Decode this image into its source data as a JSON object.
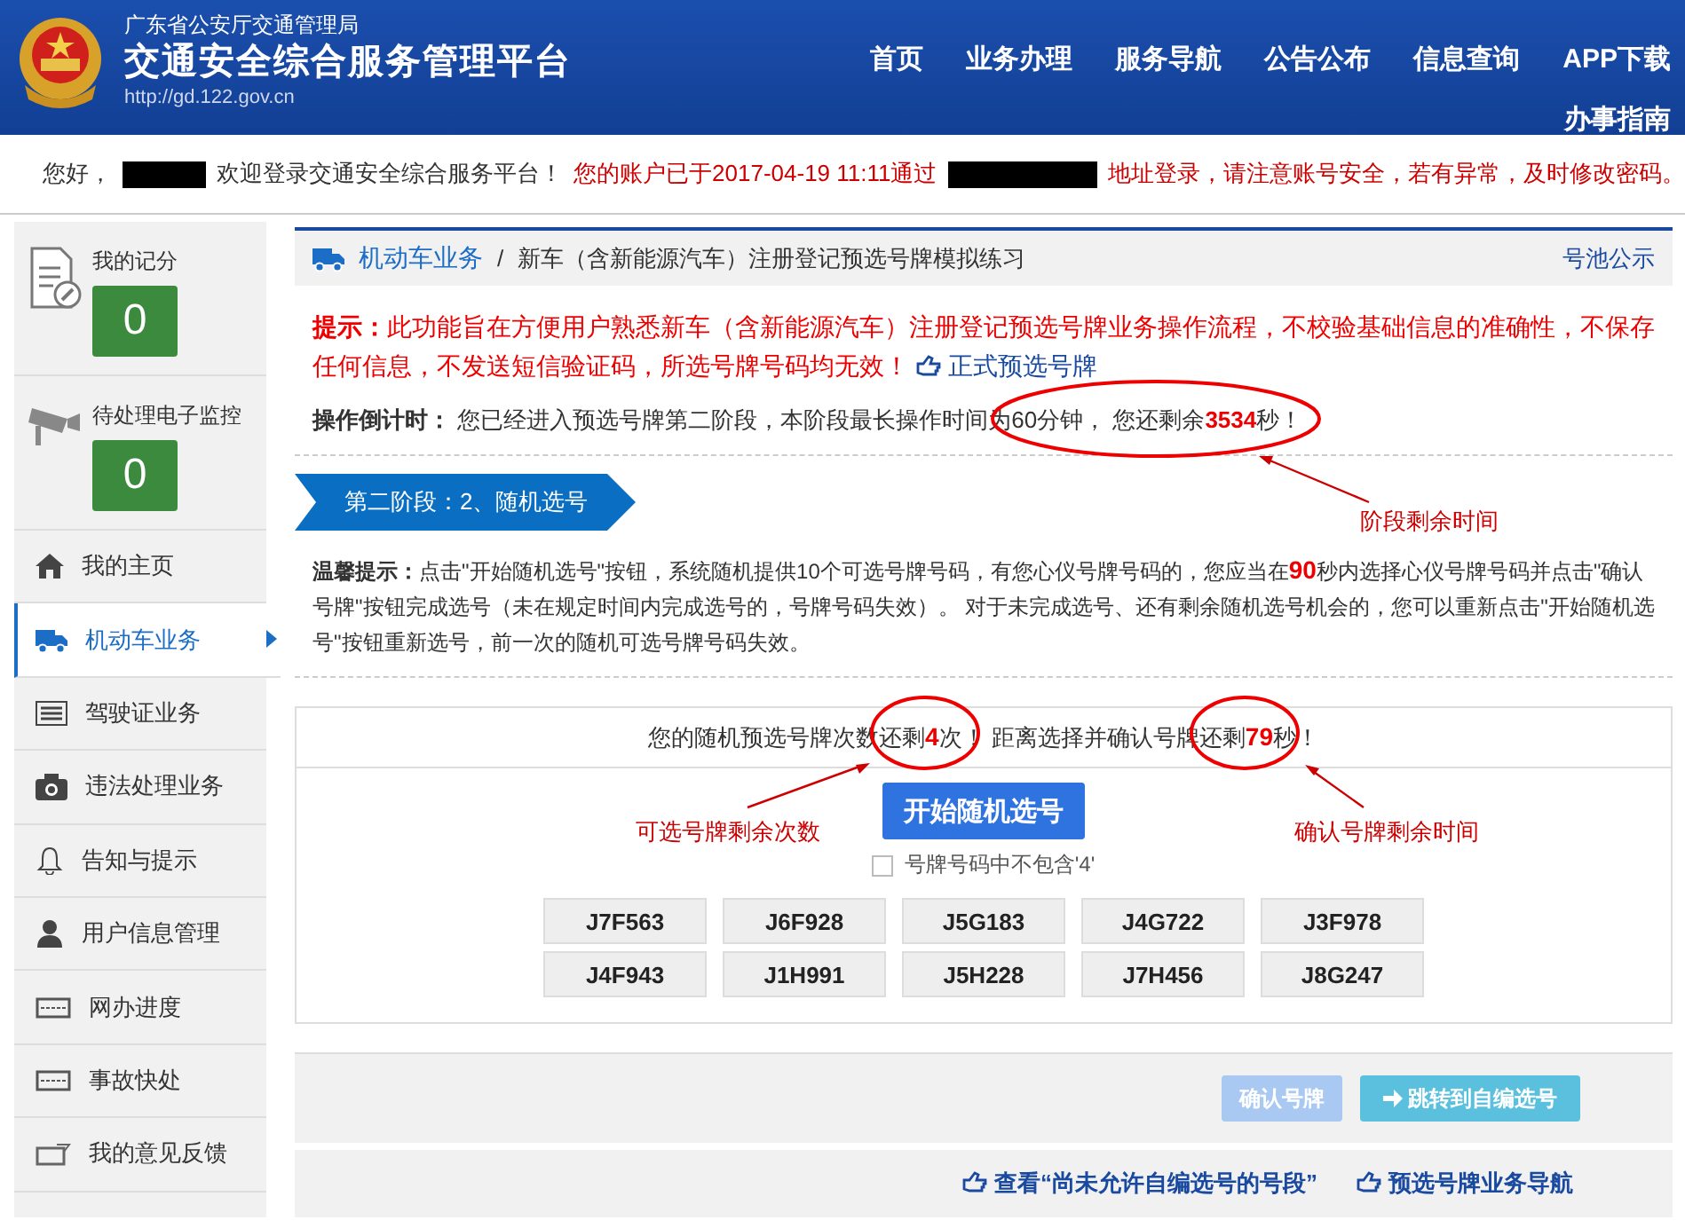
{
  "header": {
    "org": "广东省公安厅交通管理局",
    "title": "交通安全综合服务管理平台",
    "url": "http://gd.122.gov.cn",
    "nav": [
      "首页",
      "业务办理",
      "服务导航",
      "公告公布",
      "信息查询",
      "APP下载",
      "办事指南"
    ]
  },
  "welcome": {
    "greeting": "您好，",
    "welcome": "欢迎登录交通安全综合服务平台！",
    "notice_before": "您的账户已于2017-04-19 11:11通过",
    "notice_after": "地址登录，请注意账号安全，若有异常，及时修改密码。"
  },
  "sidebar": {
    "counters": [
      {
        "label": "我的记分",
        "value": "0"
      },
      {
        "label": "待处理电子监控",
        "value": "0"
      }
    ],
    "items": [
      {
        "label": "我的主页",
        "selected": false
      },
      {
        "label": "机动车业务",
        "selected": true
      },
      {
        "label": "驾驶证业务",
        "selected": false
      },
      {
        "label": "违法处理业务",
        "selected": false
      },
      {
        "label": "告知与提示",
        "selected": false
      },
      {
        "label": "用户信息管理",
        "selected": false
      },
      {
        "label": "网办进度",
        "selected": false
      },
      {
        "label": "事故快处",
        "selected": false
      },
      {
        "label": "我的意见反馈",
        "selected": false
      }
    ]
  },
  "breadcrumb": {
    "section": "机动车业务",
    "separator": "/",
    "page": "新车（含新能源汽车）注册登记预选号牌模拟练习",
    "link": "号池公示"
  },
  "hint": {
    "text": "**提示：**此功能旨在方便用户熟悉新车（含新能源汽车）注册登记预选号牌业务操作流程，不校验基础信息的准确性，不保存任何信息，不发送短信验证码，所选号牌号码均无效！",
    "link": "正式预选号牌"
  },
  "countdown": {
    "label": "操作倒计时：",
    "text": "您已经进入预选号牌第二阶段，本阶段最长操作时间为60分钟， 您还剩余**3534**秒！"
  },
  "stage": "第二阶段：2、随机选号",
  "tip": "**温馨提示：**点击\"开始随机选号\"按钮，系统随机提供10个可选号牌号码，有您心仪号牌号码的，您应当在**90**秒内选择心仪号牌号码并点击\"确认号牌\"按钮完成选号（未在规定时间内完成选号的，号牌号码失效）。 对于未完成选号、还有剩余随机选号机会的，您可以重新点击\"开始随机选号\"按钮重新选号，前一次的随机可选号牌号码失效。",
  "selection": {
    "status": "您的随机预选号牌次数还剩**4**次！ 距离选择并确认号牌还剩**79**秒！",
    "start_button": "开始随机选号",
    "filter": {
      "label": "号牌号码中不包含'4'",
      "checked": false
    },
    "plates": [
      "J7F563",
      "J6F928",
      "J5G183",
      "J4G722",
      "J3F978",
      "J4F943",
      "J1H991",
      "J5H228",
      "J7H456",
      "J8G247"
    ]
  },
  "actions": {
    "confirm": {
      "label": "确认号牌",
      "disabled": true
    },
    "jump": {
      "label": "跳转到自编选号",
      "disabled": false
    }
  },
  "footer_links": [
    "查看“尚未允许自编选号的号段”",
    "预选号牌业务导航"
  ],
  "annotations": [
    "阶段剩余时间",
    "可选号牌剩余次数",
    "确认号牌剩余时间"
  ]
}
